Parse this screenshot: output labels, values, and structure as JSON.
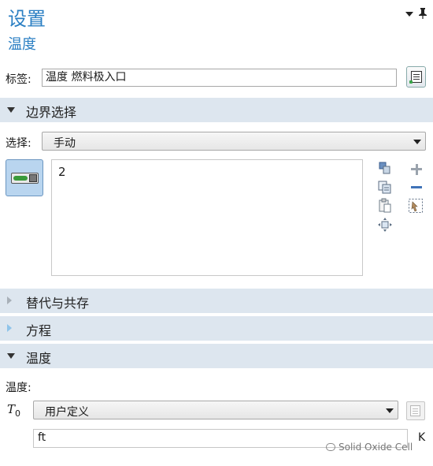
{
  "header": {
    "title": "设置",
    "subtitle": "温度",
    "menu_icon": "dropdown-arrow-icon",
    "pin_icon": "pin-icon"
  },
  "label_row": {
    "label": "标签:",
    "value": "温度 燃料极入口",
    "button_icon": "label-note-icon"
  },
  "sections": {
    "boundary_selection": "边界选择",
    "override": "替代与共存",
    "equation": "方程",
    "temperature": "温度"
  },
  "selection": {
    "label": "选择:",
    "value": "手动",
    "active_toggle_icon": "activate-selection-toggle-icon",
    "list_items": [
      "2"
    ],
    "tools": [
      "paste-selection-icon",
      "copy-selection-icon",
      "clear-selection-icon",
      "zoom-to-selection-icon",
      "add-icon",
      "remove-icon",
      "create-selection-icon"
    ]
  },
  "temperature": {
    "label": "温度:",
    "symbol": "T",
    "symbol_sub": "0",
    "source": "用户定义",
    "value": "ft",
    "unit": "K"
  },
  "watermark": "Solid Oxide Cell",
  "colors": {
    "title_blue": "#2b7fc3",
    "section_bg": "#dde6ef",
    "toggle_active": "#b9d5ef",
    "toggle_green": "#3a9a3a"
  }
}
